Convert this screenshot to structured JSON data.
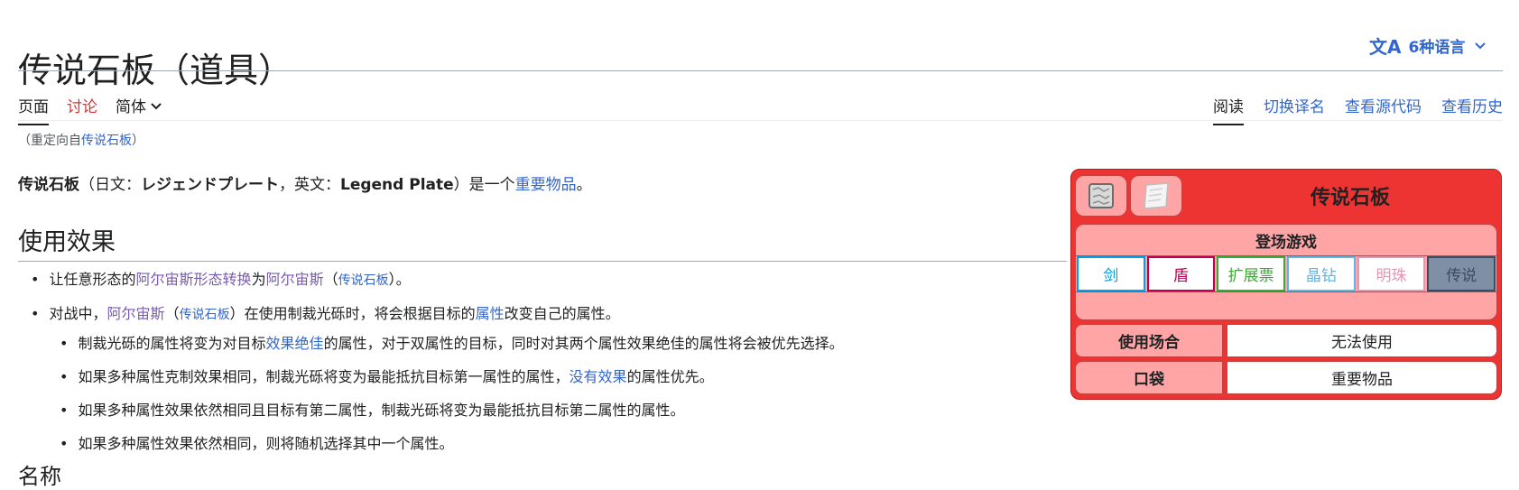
{
  "page": {
    "title": "传说石板（道具）",
    "languages_label": "6种语言",
    "lang_icon_glyph": "文A"
  },
  "tabs": {
    "left": [
      {
        "label": "页面",
        "state": "selected"
      },
      {
        "label": "讨论",
        "state": "new"
      },
      {
        "label": "简体",
        "state": "dropdown"
      }
    ],
    "right": [
      {
        "label": "阅读",
        "state": "selected"
      },
      {
        "label": "切换译名"
      },
      {
        "label": "查看源代码"
      },
      {
        "label": "查看历史"
      }
    ]
  },
  "redirect": {
    "prefix": "（重定向自",
    "link": "传说石板",
    "suffix": "）"
  },
  "lead": {
    "term": "传说石板",
    "part1": "（日文：",
    "ja": "レジェンドプレート",
    "part2": "，英文：",
    "en": "Legend Plate",
    "part3": "）是一个",
    "link": "重要物品",
    "end": "。"
  },
  "section": {
    "heading": "使用效果",
    "items": [
      {
        "t1": "让任意形态的",
        "l1": "阿尔宙斯形态转换",
        "t2": "为",
        "l2": "阿尔宙斯",
        "t3": "（",
        "l3": "传说石板",
        "t4": "）。"
      },
      {
        "t1": "对战中，",
        "l1": "阿尔宙斯",
        "t2": "（",
        "l2": "传说石板",
        "t3": "）在使用制裁光砾时，将会根据目标的",
        "l3": "属性",
        "t4": "改变自己的属性。"
      }
    ],
    "subitems": [
      {
        "t1": "制裁光砾的属性将变为对目标",
        "l1": "效果绝佳",
        "t2": "的属性，对于双属性的目标，同时对其两个属性效果绝佳的属性将会被优先选择。"
      },
      {
        "t1": "如果多种属性克制效果相同，制裁光砾将变为最能抵抗目标第一属性的属性，",
        "l1": "没有效果",
        "t2": "的属性优先。"
      },
      {
        "t1": "如果多种属性效果依然相同且目标有第二属性，制裁光砾将变为最能抵抗目标第二属性的属性。"
      },
      {
        "t1": "如果多种属性效果依然相同，则将随机选择其中一个属性。"
      }
    ],
    "next_heading": "名称"
  },
  "infobox": {
    "title": "传说石板",
    "images": [
      "legend-plate-sprite-icon",
      "legend-plate-artwork-icon"
    ],
    "games_header": "登场游戏",
    "games": [
      {
        "label": "剑",
        "color": "#00a1e9",
        "bg": "#ffffff"
      },
      {
        "label": "盾",
        "color": "#bf004f",
        "bg": "#ffffff"
      },
      {
        "label": "扩展票",
        "color": "#3aaa35",
        "bg": "#ffffff"
      },
      {
        "label": "晶钻",
        "color": "#5db6e3",
        "bg": "#ffffff"
      },
      {
        "label": "明珠",
        "color": "#e895b1",
        "bg": "#ffffff"
      },
      {
        "label": "传说",
        "color": "#3e4a5e",
        "bg": "#7f8fa6"
      }
    ],
    "rows": [
      {
        "label": "使用场合",
        "value": "无法使用"
      },
      {
        "label": "口袋",
        "value": "重要物品"
      }
    ],
    "accent_color": "#ee3333",
    "light_color": "#ffa5a5"
  }
}
